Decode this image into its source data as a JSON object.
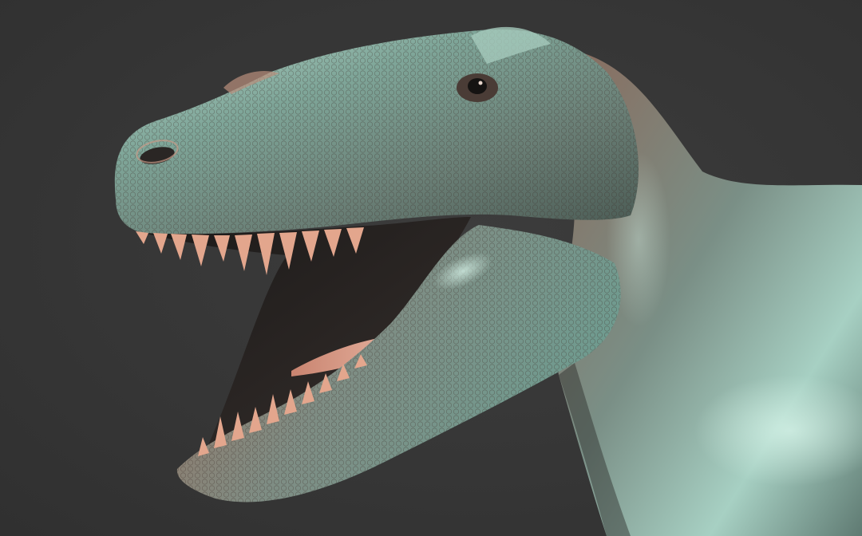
{
  "scene": {
    "subject_icon": "dinosaur-icon",
    "colors": {
      "background": "#363636",
      "skin_teal": "#6f9c90",
      "skin_copper": "#9a6a55",
      "mouth_interior": "#d08f7c",
      "teeth": "#e3a68d",
      "shadow": "#1c1a19"
    }
  }
}
